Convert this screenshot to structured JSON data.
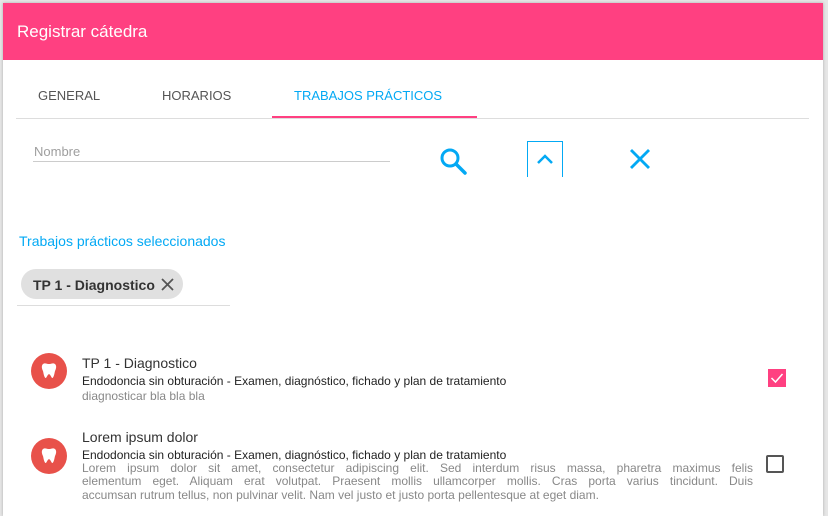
{
  "header": {
    "title": "Registrar cátedra"
  },
  "tabs": [
    {
      "label": "GENERAL"
    },
    {
      "label": "HORARIOS"
    },
    {
      "label": "TRABAJOS PRÁCTICOS"
    }
  ],
  "search": {
    "placeholder": "Nombre",
    "value": ""
  },
  "selected_section": {
    "label": "Trabajos prácticos seleccionados",
    "chips": [
      {
        "label": "TP 1 - Diagnostico"
      }
    ]
  },
  "items": [
    {
      "title": "TP 1 - Diagnostico",
      "subtitle": "Endodoncia sin obturación - Examen, diagnóstico, fichado y plan de tratamiento",
      "description": "diagnosticar bla bla bla",
      "checked": true
    },
    {
      "title": "Lorem ipsum dolor",
      "subtitle": "Endodoncia sin obturación - Examen, diagnóstico, fichado y plan de tratamiento",
      "description_lines": [
        "Lorem ipsum dolor sit amet, consectetur adipiscing elit. Sed interdum risus massa, pharetra maximus felis",
        "elementum eget. Aliquam erat volutpat. Praesent mollis ullamcorper mollis. Cras porta varius tincidunt. Duis",
        "accumsan rutrum tellus, non pulvinar velit. Nam vel justo et justo porta pellentesque at eget diam."
      ],
      "checked": false
    }
  ],
  "colors": {
    "primary": "#ff4081",
    "accent": "#03a9f4",
    "avatar": "#e8514a"
  },
  "icons": [
    "search-icon",
    "chevron-up-icon",
    "close-icon",
    "tooth-icon",
    "check-icon"
  ]
}
